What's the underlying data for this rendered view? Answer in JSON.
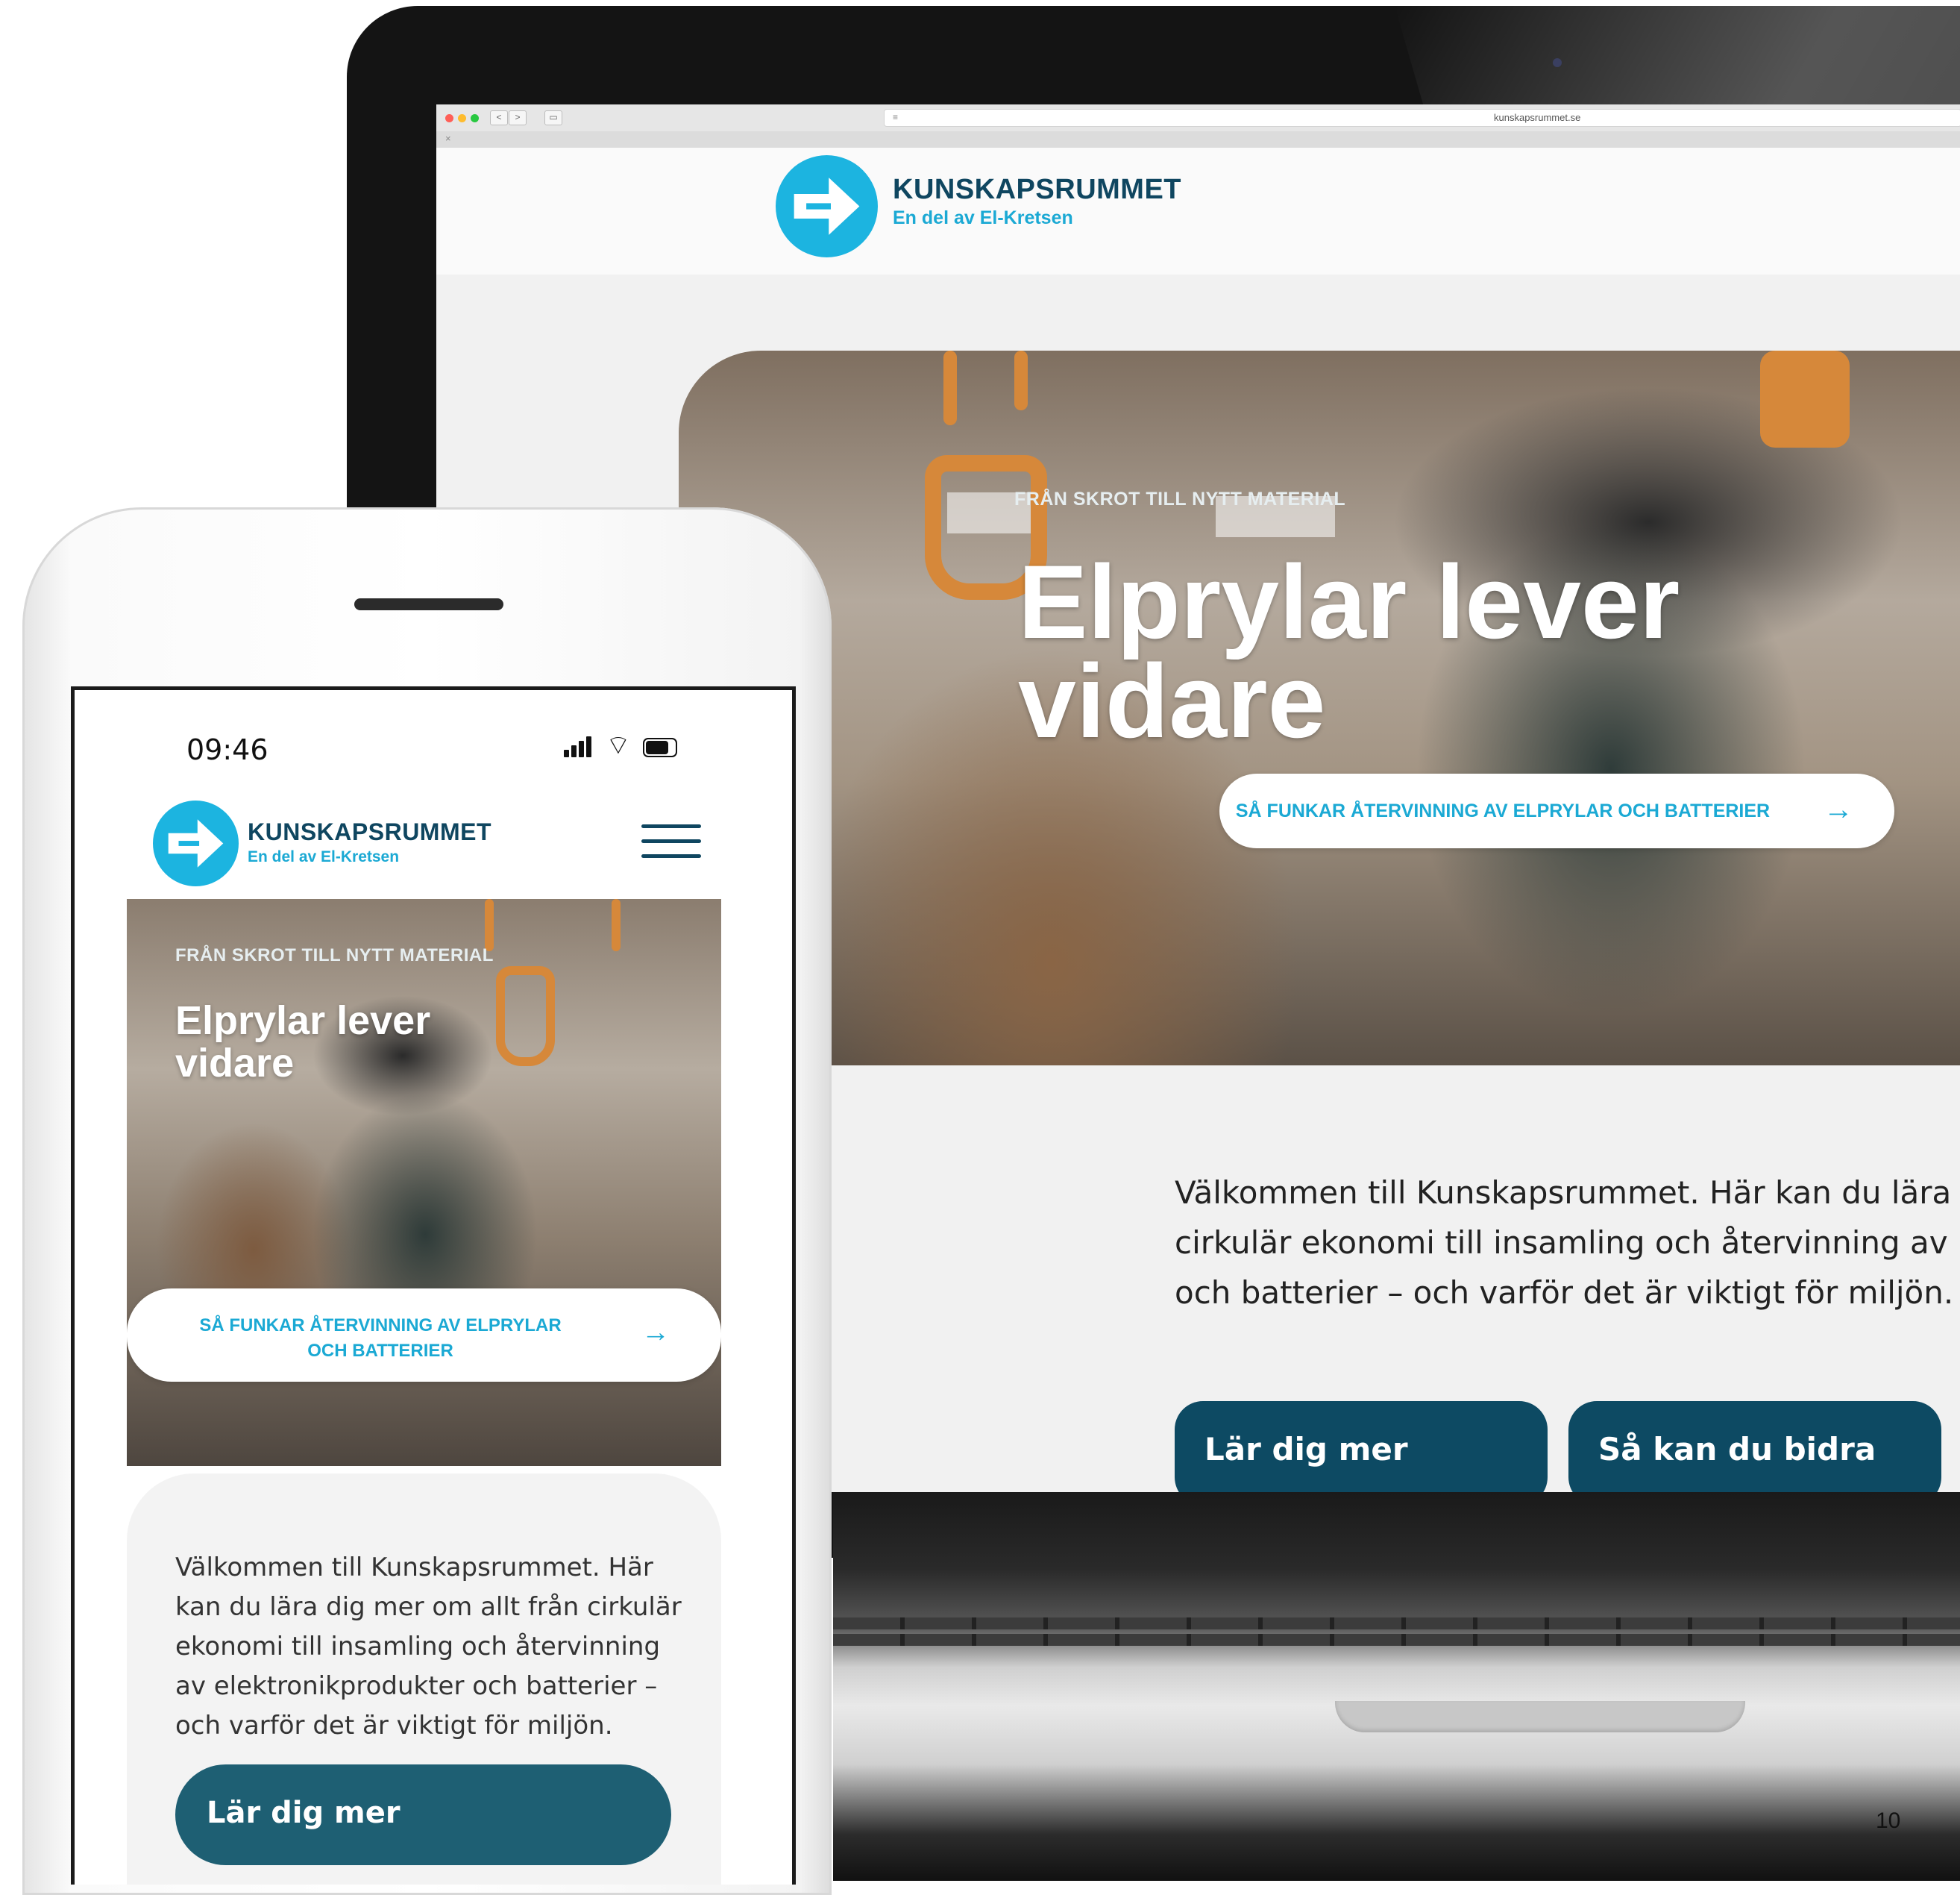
{
  "browser": {
    "url": "kunskapsrummet.se",
    "back": "<",
    "forward": ">",
    "tab_close": "×"
  },
  "brand": {
    "name": "KUNSKAPSRUMMET",
    "tagline": "En del av El-Kretsen",
    "logo_icon": "arrow-right-circle-icon",
    "color_primary": "#0f4660",
    "color_accent": "#1ba9d4"
  },
  "hero": {
    "kicker": "FRÅN SKROT TILL NYTT MATERIAL",
    "title_line1": "Elprylar lever",
    "title_line2": "vidare",
    "cta_label": "SÅ FUNKAR ÅTERVINNING AV ELPRYLAR OCH BATTERIER",
    "cta_arrow": "→"
  },
  "intro": {
    "desktop_line1": "Välkommen till Kunskapsrummet. Här kan du lära",
    "desktop_line2": "cirkulär ekonomi till insamling och återvinning av",
    "desktop_line3": "och batterier – och varför det är viktigt för miljön.",
    "mobile_line1": "Välkommen till Kunskapsrummet. Här",
    "mobile_line2": "kan du lära dig mer om allt från cirkulär",
    "mobile_line3": "ekonomi till insamling och återvinning",
    "mobile_line4": "av elektronikprodukter och batterier –",
    "mobile_line5": "och varför det är viktigt för miljön."
  },
  "buttons": {
    "learn_more": "Lär dig mer",
    "contribute": "Så kan du bidra"
  },
  "mobile": {
    "status_time": "09:46",
    "menu_icon": "hamburger-menu-icon",
    "cta_line1": "SÅ FUNKAR ÅTERVINNING AV ELPRYLAR",
    "cta_line2": "OCH BATTERIER"
  },
  "page_number": "10"
}
